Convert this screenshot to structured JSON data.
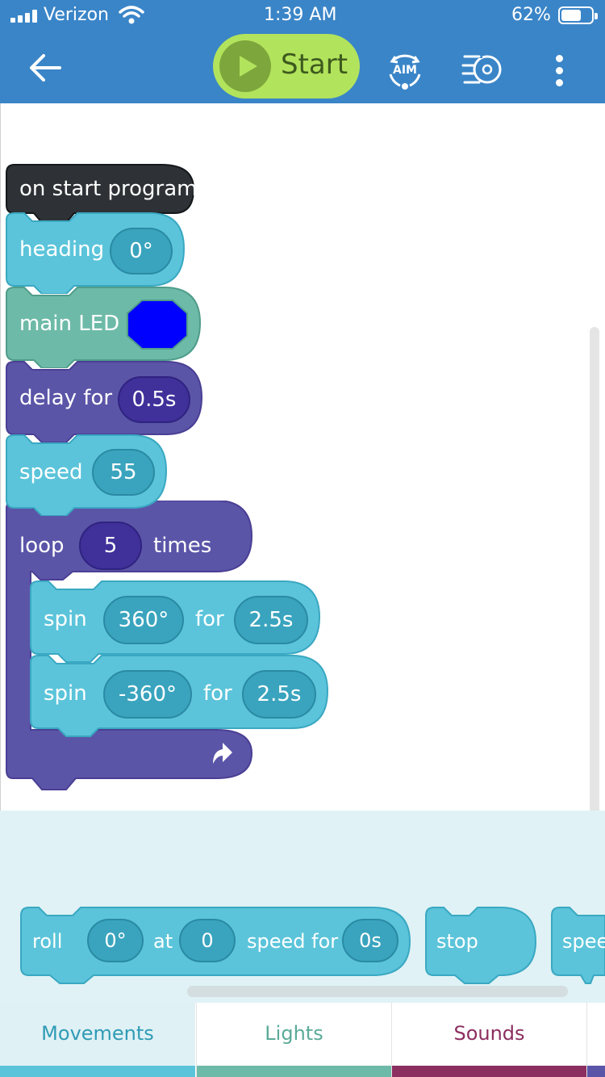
{
  "status_bar": {
    "carrier": "Verizon",
    "time": "1:39 AM",
    "battery": "62%"
  },
  "header": {
    "start_label": "Start",
    "aim_label": "AIM"
  },
  "program": {
    "start_block": "on start program",
    "heading": {
      "label": "heading",
      "value": "0°"
    },
    "main_led": {
      "label": "main LED",
      "color": "#0000ff"
    },
    "delay": {
      "label": "delay for",
      "value": "0.5s"
    },
    "speed": {
      "label": "speed",
      "value": "55"
    },
    "loop": {
      "label": "loop",
      "count": "5",
      "suffix": "times"
    },
    "spins": [
      {
        "label": "spin",
        "angle": "360°",
        "for_label": "for",
        "duration": "2.5s"
      },
      {
        "label": "spin",
        "angle": "-360°",
        "for_label": "for",
        "duration": "2.5s"
      }
    ]
  },
  "palette": {
    "roll": {
      "label": "roll",
      "heading": "0°",
      "at_label": "at",
      "speed": "0",
      "speed_for_label": "speed for",
      "duration": "0s"
    },
    "stop": {
      "label": "stop"
    },
    "partial": {
      "label": "spee"
    }
  },
  "tabs": [
    {
      "label": "Movements",
      "active": true
    },
    {
      "label": "Lights",
      "active": false
    },
    {
      "label": "Sounds",
      "active": false
    }
  ],
  "colors": {
    "header": "#3a85c8",
    "start": "#b2e35c",
    "movement_block": "#5bc4da",
    "light_block": "#6ebaa8",
    "control_block": "#5b55a8",
    "sound_tab": "#8c2f60"
  }
}
